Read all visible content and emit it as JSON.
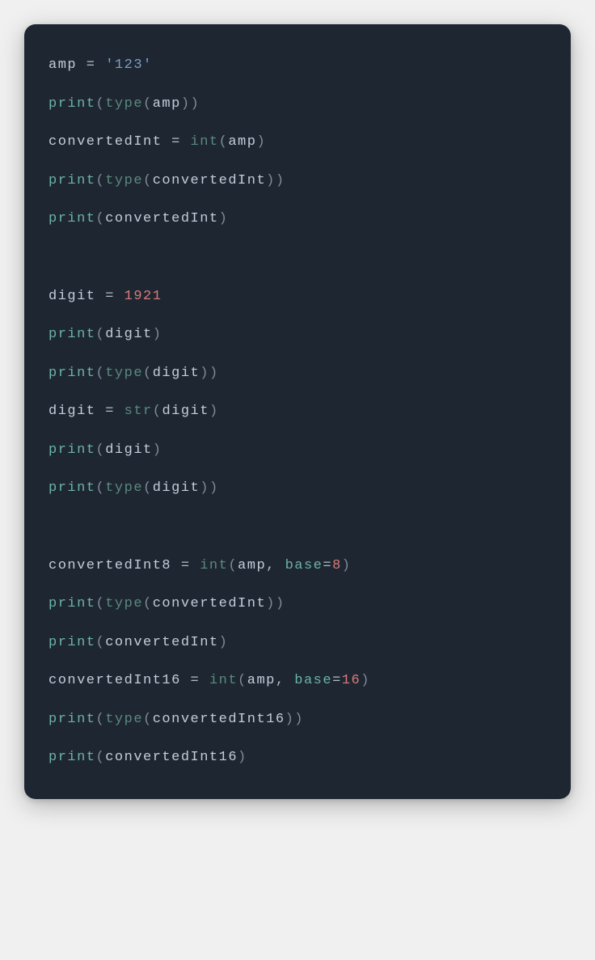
{
  "code": {
    "l1_var": "amp",
    "l1_op": " = ",
    "l1_str": "'123'",
    "l2_fn": "print",
    "l2_p1": "(",
    "l2_type": "type",
    "l2_p2": "(",
    "l2_arg": "amp",
    "l2_p3": ")",
    "l2_p4": ")",
    "l3_var": "convertedInt",
    "l3_op": " = ",
    "l3_int": "int",
    "l3_p1": "(",
    "l3_arg": "amp",
    "l3_p2": ")",
    "l4_fn": "print",
    "l4_p1": "(",
    "l4_type": "type",
    "l4_p2": "(",
    "l4_arg": "convertedInt",
    "l4_p3": ")",
    "l4_p4": ")",
    "l5_fn": "print",
    "l5_p1": "(",
    "l5_arg": "convertedInt",
    "l5_p2": ")",
    "l6_var": "digit",
    "l6_op": " = ",
    "l6_num": "1921",
    "l7_fn": "print",
    "l7_p1": "(",
    "l7_arg": "digit",
    "l7_p2": ")",
    "l8_fn": "print",
    "l8_p1": "(",
    "l8_type": "type",
    "l8_p2": "(",
    "l8_arg": "digit",
    "l8_p3": ")",
    "l8_p4": ")",
    "l9_var": "digit",
    "l9_op": " = ",
    "l9_str": "str",
    "l9_p1": "(",
    "l9_arg": "digit",
    "l9_p2": ")",
    "l10_fn": "print",
    "l10_p1": "(",
    "l10_arg": "digit",
    "l10_p2": ")",
    "l11_fn": "print",
    "l11_p1": "(",
    "l11_type": "type",
    "l11_p2": "(",
    "l11_arg": "digit",
    "l11_p3": ")",
    "l11_p4": ")",
    "l12_var": "convertedInt8",
    "l12_op": " = ",
    "l12_int": "int",
    "l12_p1": "(",
    "l12_arg1": "amp",
    "l12_comma": ", ",
    "l12_kw": "base",
    "l12_eq": "=",
    "l12_num": "8",
    "l12_p2": ")",
    "l13_fn": "print",
    "l13_p1": "(",
    "l13_type": "type",
    "l13_p2": "(",
    "l13_arg": "convertedInt",
    "l13_p3": ")",
    "l13_p4": ")",
    "l14_fn": "print",
    "l14_p1": "(",
    "l14_arg": "convertedInt",
    "l14_p2": ")",
    "l15_var": "convertedInt16",
    "l15_op": " = ",
    "l15_int": "int",
    "l15_p1": "(",
    "l15_arg1": "amp",
    "l15_comma": ", ",
    "l15_kw": "base",
    "l15_eq": "=",
    "l15_num": "16",
    "l15_p2": ")",
    "l16_fn": "print",
    "l16_p1": "(",
    "l16_type": "type",
    "l16_p2": "(",
    "l16_arg": "convertedInt16",
    "l16_p3": ")",
    "l16_p4": ")",
    "l17_fn": "print",
    "l17_p1": "(",
    "l17_arg": "convertedInt16",
    "l17_p2": ")"
  }
}
